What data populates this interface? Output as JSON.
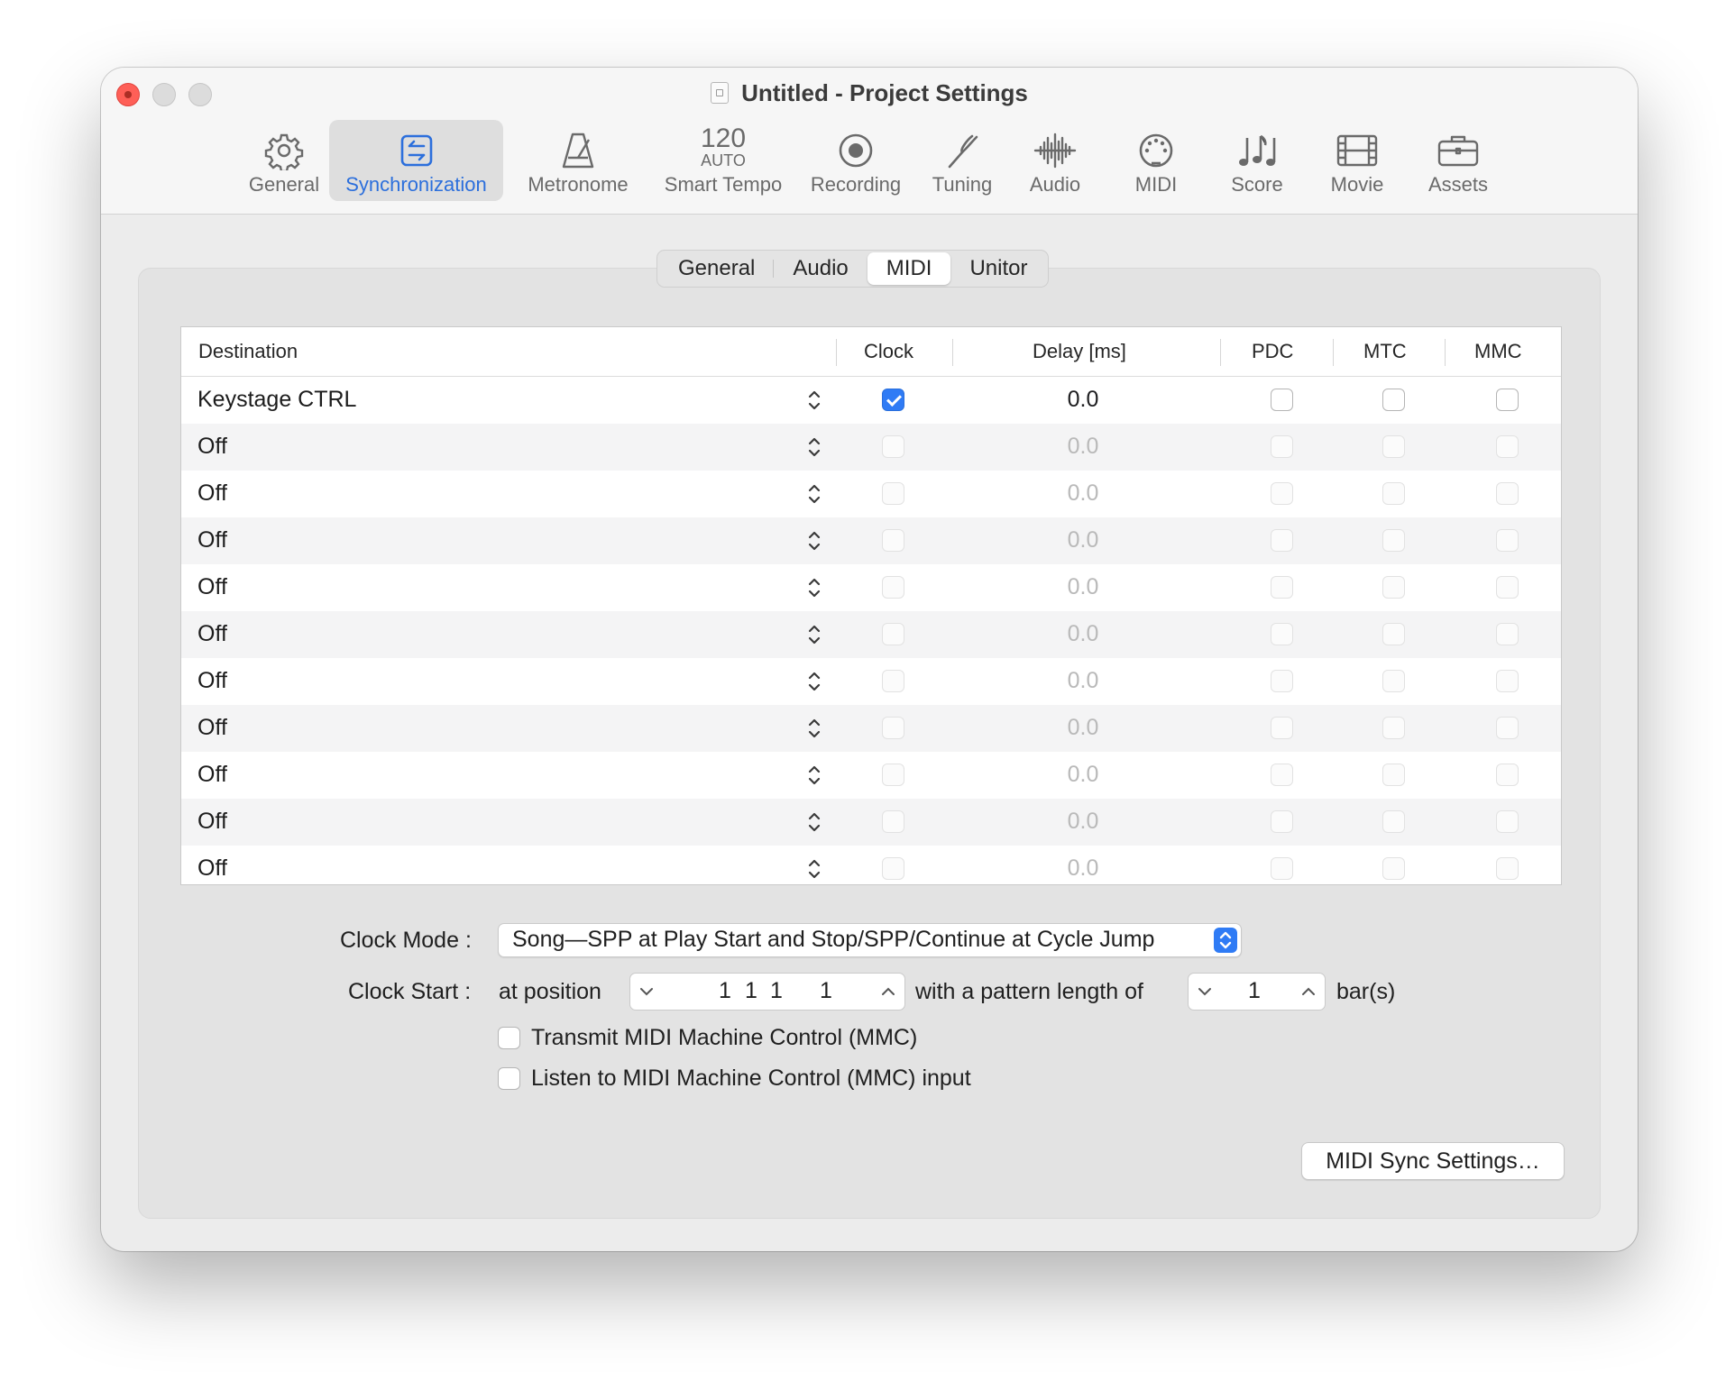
{
  "window": {
    "title": "Untitled - Project Settings"
  },
  "toolbar": {
    "items": [
      {
        "label": "General",
        "icon": "gear-icon"
      },
      {
        "label": "Synchronization",
        "icon": "sync-icon",
        "active": true
      },
      {
        "label": "Metronome",
        "icon": "metronome-icon"
      },
      {
        "label": "Smart Tempo",
        "icon": "tempo-icon",
        "number": "120",
        "sub": "AUTO"
      },
      {
        "label": "Recording",
        "icon": "record-icon"
      },
      {
        "label": "Tuning",
        "icon": "tuning-fork-icon"
      },
      {
        "label": "Audio",
        "icon": "waveform-icon"
      },
      {
        "label": "MIDI",
        "icon": "midi-port-icon"
      },
      {
        "label": "Score",
        "icon": "music-notes-icon"
      },
      {
        "label": "Movie",
        "icon": "film-icon"
      },
      {
        "label": "Assets",
        "icon": "briefcase-icon"
      }
    ]
  },
  "tabs": {
    "items": [
      "General",
      "Audio",
      "MIDI",
      "Unitor"
    ],
    "selected": "MIDI"
  },
  "table": {
    "headers": {
      "destination": "Destination",
      "clock": "Clock",
      "delay": "Delay [ms]",
      "pdc": "PDC",
      "mtc": "MTC",
      "mmc": "MMC"
    },
    "rows": [
      {
        "destination": "Keystage CTRL",
        "clock": true,
        "delay": "0.0",
        "pdc": false,
        "mtc": false,
        "mmc": false,
        "enabled": true
      },
      {
        "destination": "Off",
        "clock": false,
        "delay": "0.0",
        "pdc": false,
        "mtc": false,
        "mmc": false,
        "enabled": false
      },
      {
        "destination": "Off",
        "clock": false,
        "delay": "0.0",
        "pdc": false,
        "mtc": false,
        "mmc": false,
        "enabled": false
      },
      {
        "destination": "Off",
        "clock": false,
        "delay": "0.0",
        "pdc": false,
        "mtc": false,
        "mmc": false,
        "enabled": false
      },
      {
        "destination": "Off",
        "clock": false,
        "delay": "0.0",
        "pdc": false,
        "mtc": false,
        "mmc": false,
        "enabled": false
      },
      {
        "destination": "Off",
        "clock": false,
        "delay": "0.0",
        "pdc": false,
        "mtc": false,
        "mmc": false,
        "enabled": false
      },
      {
        "destination": "Off",
        "clock": false,
        "delay": "0.0",
        "pdc": false,
        "mtc": false,
        "mmc": false,
        "enabled": false
      },
      {
        "destination": "Off",
        "clock": false,
        "delay": "0.0",
        "pdc": false,
        "mtc": false,
        "mmc": false,
        "enabled": false
      },
      {
        "destination": "Off",
        "clock": false,
        "delay": "0.0",
        "pdc": false,
        "mtc": false,
        "mmc": false,
        "enabled": false
      },
      {
        "destination": "Off",
        "clock": false,
        "delay": "0.0",
        "pdc": false,
        "mtc": false,
        "mmc": false,
        "enabled": false
      },
      {
        "destination": "Off",
        "clock": false,
        "delay": "0.0",
        "pdc": false,
        "mtc": false,
        "mmc": false,
        "enabled": false
      }
    ]
  },
  "clock_mode": {
    "label": "Clock Mode :",
    "value": "Song—SPP at Play Start and Stop/SPP/Continue at Cycle Jump"
  },
  "clock_start": {
    "label": "Clock Start :",
    "at_position_label": "at position",
    "position": [
      "1",
      "1",
      "1",
      "1"
    ],
    "pattern_label": "with a pattern length of",
    "pattern_length": "1",
    "unit": "bar(s)"
  },
  "options": {
    "transmit_mmc": {
      "label": "Transmit MIDI Machine Control (MMC)",
      "checked": false
    },
    "listen_mmc": {
      "label": "Listen to MIDI Machine Control (MMC) input",
      "checked": false
    }
  },
  "midi_sync_button": "MIDI Sync Settings…",
  "colors": {
    "accent": "#2f7bf5",
    "close": "#fe5f57"
  }
}
